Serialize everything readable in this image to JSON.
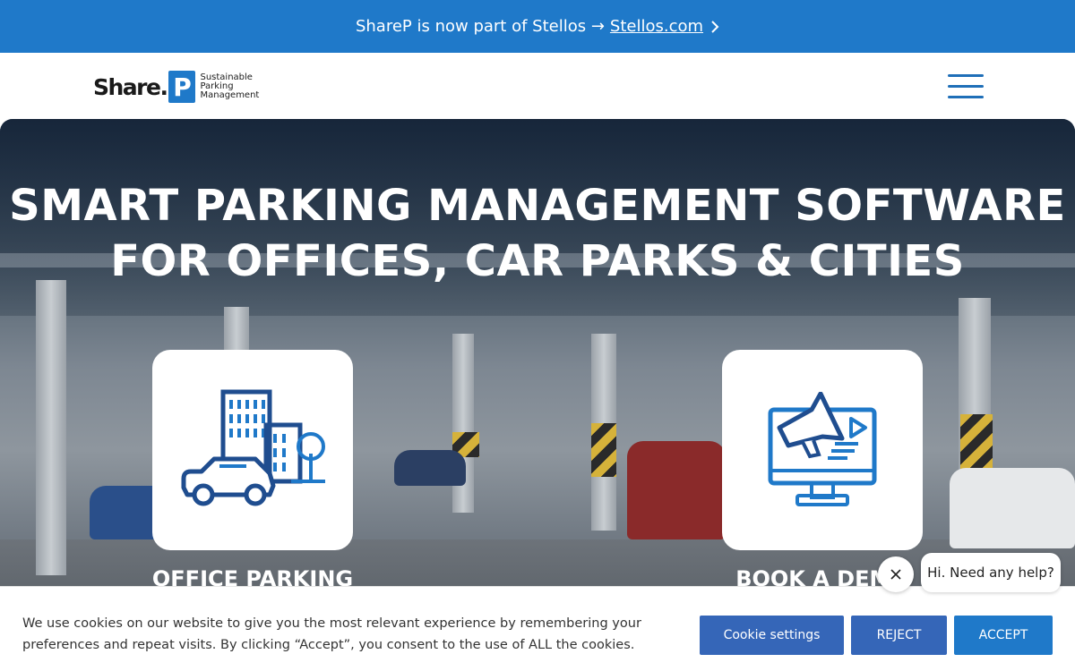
{
  "announcement": {
    "text": "ShareP is now part of Stellos →",
    "link": "Stellos.com"
  },
  "header": {
    "logo": {
      "word": "Share.",
      "p": "P",
      "tm": "™",
      "tagline": [
        "Sustainable",
        "Parking",
        "Management"
      ]
    },
    "menu_icon": "hamburger-icon"
  },
  "hero": {
    "title_line1": "SMART PARKING MANAGEMENT SOFTWARE",
    "title_line2": "FOR OFFICES, CAR PARKS & CITIES",
    "cards": [
      {
        "label": "OFFICE PARKING",
        "icon": "office-building-car-icon"
      },
      {
        "label": "BOOK A DEMO",
        "icon": "monitor-megaphone-icon"
      }
    ]
  },
  "chat": {
    "greeting": "Hi. Need any help?",
    "close_icon": "close-icon"
  },
  "cookie_banner": {
    "message": "We use cookies on our website to give you the most relevant experience by remembering your preferences and repeat visits. By clicking “Accept”, you consent to the use of ALL the cookies.",
    "settings_label": "Cookie settings",
    "reject_label": "REJECT",
    "accept_label": "ACCEPT"
  },
  "colors": {
    "brand_blue": "#1f79c9",
    "button_blue": "#3566b8",
    "icon_dark_blue": "#1f4d8f"
  }
}
